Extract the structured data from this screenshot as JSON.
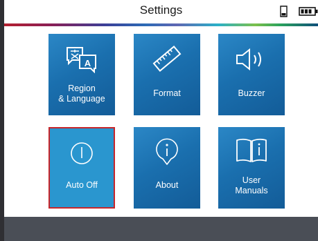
{
  "header": {
    "title": "Settings"
  },
  "status": {
    "storage_icon": "sd-card-icon",
    "battery_icon": "battery-icon"
  },
  "tiles": [
    {
      "label": "Region\n& Language",
      "icon": "language-icon"
    },
    {
      "label": "Format",
      "icon": "ruler-icon"
    },
    {
      "label": "Buzzer",
      "icon": "speaker-icon"
    },
    {
      "label": "Auto Off",
      "icon": "power-icon"
    },
    {
      "label": "About",
      "icon": "info-icon"
    },
    {
      "label": "User\nManuals",
      "icon": "manual-icon"
    }
  ],
  "colors": {
    "tile": "#1a6fae",
    "selected_tile": "#2a96cf",
    "selection_border": "#c8262b",
    "footer": "#4a4e56"
  }
}
